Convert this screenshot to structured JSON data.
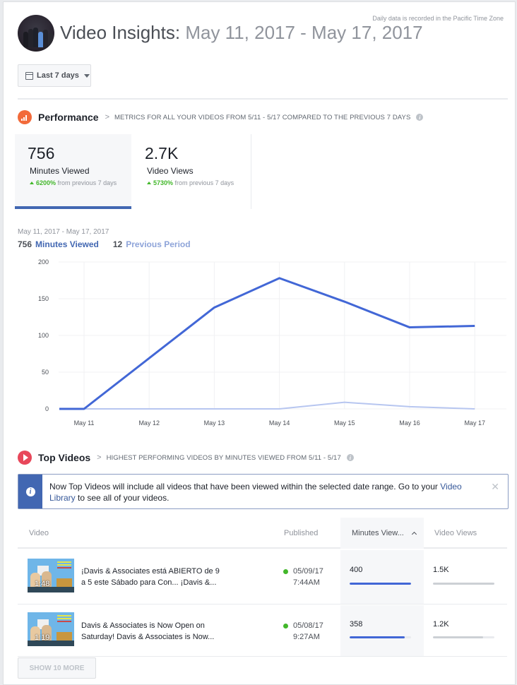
{
  "header": {
    "timezone_note": "Daily data is recorded in the Pacific Time Zone",
    "title_prefix": "Video Insights:",
    "title_range": "May 11, 2017 - May 17, 2017",
    "avatar_icon": "page-profile-photo",
    "date_range_button": {
      "label": "Last 7 days",
      "icon": "calendar-icon"
    }
  },
  "performance": {
    "title": "Performance",
    "icon": "bar-chart-icon",
    "accent_color": "#f26a3a",
    "description": "Metrics for all your videos from 5/11 - 5/17 compared to the previous 7 days",
    "metrics": [
      {
        "value": "756",
        "label": "Minutes Viewed",
        "change_pct": "6200%",
        "change_text": "from previous 7 days",
        "active": true
      },
      {
        "value": "2.7K",
        "label": "Video Views",
        "change_pct": "5730%",
        "change_text": "from previous 7 days",
        "active": false
      }
    ]
  },
  "chart_legend": {
    "range": "May 11, 2017 - May 17, 2017",
    "current_total": "756",
    "current_label": "Minutes Viewed",
    "previous_total": "12",
    "previous_label": "Previous Period"
  },
  "chart_data": {
    "type": "line",
    "title": "",
    "xlabel": "",
    "ylabel": "",
    "categories": [
      "May 11",
      "May 12",
      "May 13",
      "May 14",
      "May 15",
      "May 16",
      "May 17"
    ],
    "ylim": [
      0,
      200
    ],
    "yticks": [
      0,
      50,
      100,
      150,
      200
    ],
    "grid": true,
    "series": [
      {
        "name": "Minutes Viewed",
        "color": "#4267d6",
        "leading_value": 0,
        "values": [
          0,
          69,
          138,
          178,
          146,
          111,
          113
        ]
      },
      {
        "name": "Previous Period",
        "color": "#b7c6f0",
        "leading_value": 0,
        "values": [
          0,
          0,
          0,
          0,
          9,
          3,
          0
        ]
      }
    ]
  },
  "top_videos": {
    "title": "Top Videos",
    "icon": "play-icon",
    "accent_color": "#e8475a",
    "description": "Highest performing videos by minutes viewed from 5/11 - 5/17",
    "notice": {
      "text_before": "Now Top Videos will include all videos that have been viewed within the selected date range. Go to your ",
      "link": "Video Library",
      "text_after": " to see all of your videos."
    },
    "columns": [
      "Video",
      "Published",
      "Minutes View...",
      "Video Views"
    ],
    "rows": [
      {
        "title": "¡Davis & Associates está ABIERTO de 9 a 5 este Sábado para Con... ¡Davis &...",
        "duration": "1:48",
        "published_date": "05/09/17",
        "published_time": "7:44AM",
        "minutes_viewed": "400",
        "minutes_fraction": 1.0,
        "video_views": "1.5K",
        "views_fraction": 1.0
      },
      {
        "title": "Davis & Associates is Now Open on Saturday! Davis & Associates is Now...",
        "duration": "1:19",
        "published_date": "05/08/17",
        "published_time": "9:27AM",
        "minutes_viewed": "358",
        "minutes_fraction": 0.895,
        "video_views": "1.2K",
        "views_fraction": 0.82
      }
    ],
    "show_more_label": "SHOW 10 MORE"
  }
}
